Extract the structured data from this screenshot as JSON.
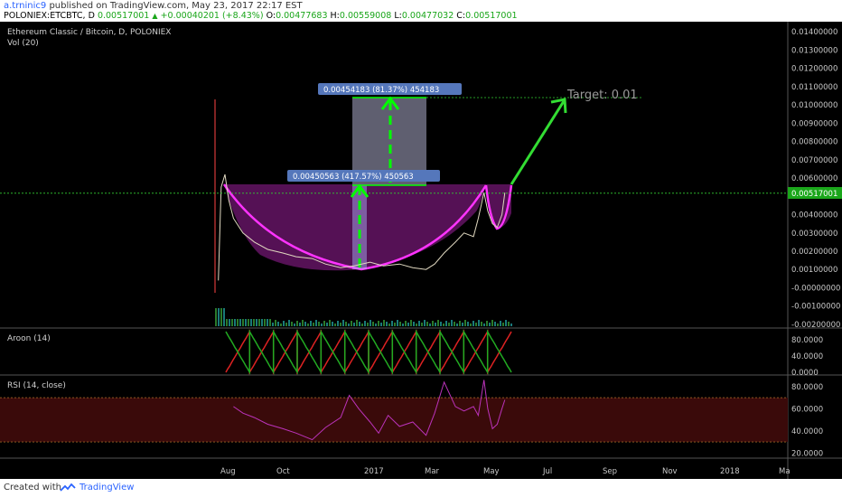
{
  "header": {
    "user": "a.trninic9",
    "published": "published on TradingView.com, May 23, 2017 22:17 EST",
    "symbol_line": {
      "symbol": "POLONIEX:ETCBTC, D",
      "price": "0.00517001",
      "change": "+0.00040201 (+8.43%)",
      "o_label": "O:",
      "o": "0.00477683",
      "h_label": "H:",
      "h": "0.00559008",
      "l_label": "L:",
      "l": "0.00477032",
      "c_label": "C:",
      "c": "0.00517001"
    }
  },
  "footer": {
    "created_with": "Created with",
    "brand": "TradingView"
  },
  "colors": {
    "background": "#000000",
    "pink": "#ff33ff",
    "green": "#33dd33",
    "aroon_up": "#22aa22",
    "aroon_down": "#dd2222",
    "rsi": "#bb33bb"
  },
  "chart_data": [
    {
      "type": "line",
      "title": "Ethereum Classic / Bitcoin, D, POLONIEX",
      "subtitle": "Vol (20)",
      "x_ticks": [
        "Aug",
        "Oct",
        "2017",
        "Mar",
        "May",
        "Jul",
        "Sep",
        "Nov",
        "2018",
        "Ma"
      ],
      "y_ticks": [
        "0.01400000",
        "0.01300000",
        "0.01200000",
        "0.01100000",
        "0.01000000",
        "0.00900000",
        "0.00800000",
        "0.00700000",
        "0.00600000",
        "0.00517001",
        "0.00400000",
        "0.00300000",
        "0.00200000",
        "0.00100000",
        "-0.00000000",
        "-0.00100000",
        "-0.00200000"
      ],
      "ylim": [
        -0.0021,
        0.0143
      ],
      "last_price": 0.00517001,
      "series": [
        {
          "x": [
            "2016-07-25",
            "2016-07-28",
            "2016-08-01",
            "2016-08-05",
            "2016-08-10",
            "2016-08-20",
            "2016-09-01",
            "2016-09-15",
            "2016-10-01",
            "2016-10-15",
            "2016-11-01",
            "2016-11-15",
            "2016-12-01",
            "2016-12-15",
            "2017-01-01",
            "2017-01-15",
            "2017-02-01",
            "2017-02-15",
            "2017-03-01",
            "2017-03-10",
            "2017-03-20",
            "2017-04-01",
            "2017-04-10",
            "2017-04-20",
            "2017-04-25",
            "2017-05-01",
            "2017-05-05",
            "2017-05-10",
            "2017-05-15",
            "2017-05-20",
            "2017-05-23"
          ],
          "y": [
            0.0004,
            0.0055,
            0.0062,
            0.0048,
            0.0038,
            0.003,
            0.0025,
            0.0021,
            0.0019,
            0.0017,
            0.0016,
            0.0013,
            0.0011,
            0.0012,
            0.0014,
            0.0012,
            0.0013,
            0.0011,
            0.001,
            0.0013,
            0.0019,
            0.0025,
            0.003,
            0.0028,
            0.0038,
            0.0052,
            0.0042,
            0.0035,
            0.0033,
            0.004,
            0.0052
          ]
        }
      ],
      "annotations": [
        {
          "text": "0.00454183 (81.37%) 454183"
        },
        {
          "text": "0.00450563 (417.57%) 450563"
        },
        {
          "text": "Target: 0.01"
        }
      ]
    },
    {
      "type": "line",
      "title": "Aroon (14)",
      "y_ticks": [
        "80.0000",
        "40.0000",
        "0.0000"
      ],
      "ylim": [
        0,
        100
      ],
      "series": [
        {
          "values": [
            100,
            92,
            84,
            77,
            69,
            61,
            54,
            46,
            38,
            31,
            23,
            15,
            8,
            0
          ]
        },
        {
          "values": [
            0,
            8,
            15,
            23,
            31,
            38,
            46,
            54,
            61,
            69,
            77,
            84,
            92,
            100
          ]
        }
      ]
    },
    {
      "type": "line",
      "title": "RSI (14, close)",
      "y_ticks": [
        "80.0000",
        "60.0000",
        "40.0000",
        "20.0000"
      ],
      "ylim": [
        17,
        88
      ],
      "bands": [
        70,
        30
      ],
      "series": [
        {
          "x": [
            "2016-08-10",
            "2016-08-20",
            "2016-09-01",
            "2016-09-15",
            "2016-10-01",
            "2016-10-15",
            "2016-11-01",
            "2016-11-15",
            "2016-12-01",
            "2016-12-10",
            "2016-12-20",
            "2017-01-01",
            "2017-01-10",
            "2017-01-20",
            "2017-02-01",
            "2017-02-15",
            "2017-03-01",
            "2017-03-10",
            "2017-03-20",
            "2017-04-01",
            "2017-04-10",
            "2017-04-20",
            "2017-04-25",
            "2017-05-01",
            "2017-05-05",
            "2017-05-10",
            "2017-05-15",
            "2017-05-20",
            "2017-05-23"
          ],
          "y": [
            62,
            56,
            52,
            46,
            42,
            38,
            32,
            43,
            52,
            72,
            60,
            48,
            38,
            54,
            44,
            48,
            36,
            56,
            84,
            62,
            58,
            62,
            54,
            86,
            60,
            42,
            46,
            60,
            68
          ]
        }
      ]
    }
  ]
}
